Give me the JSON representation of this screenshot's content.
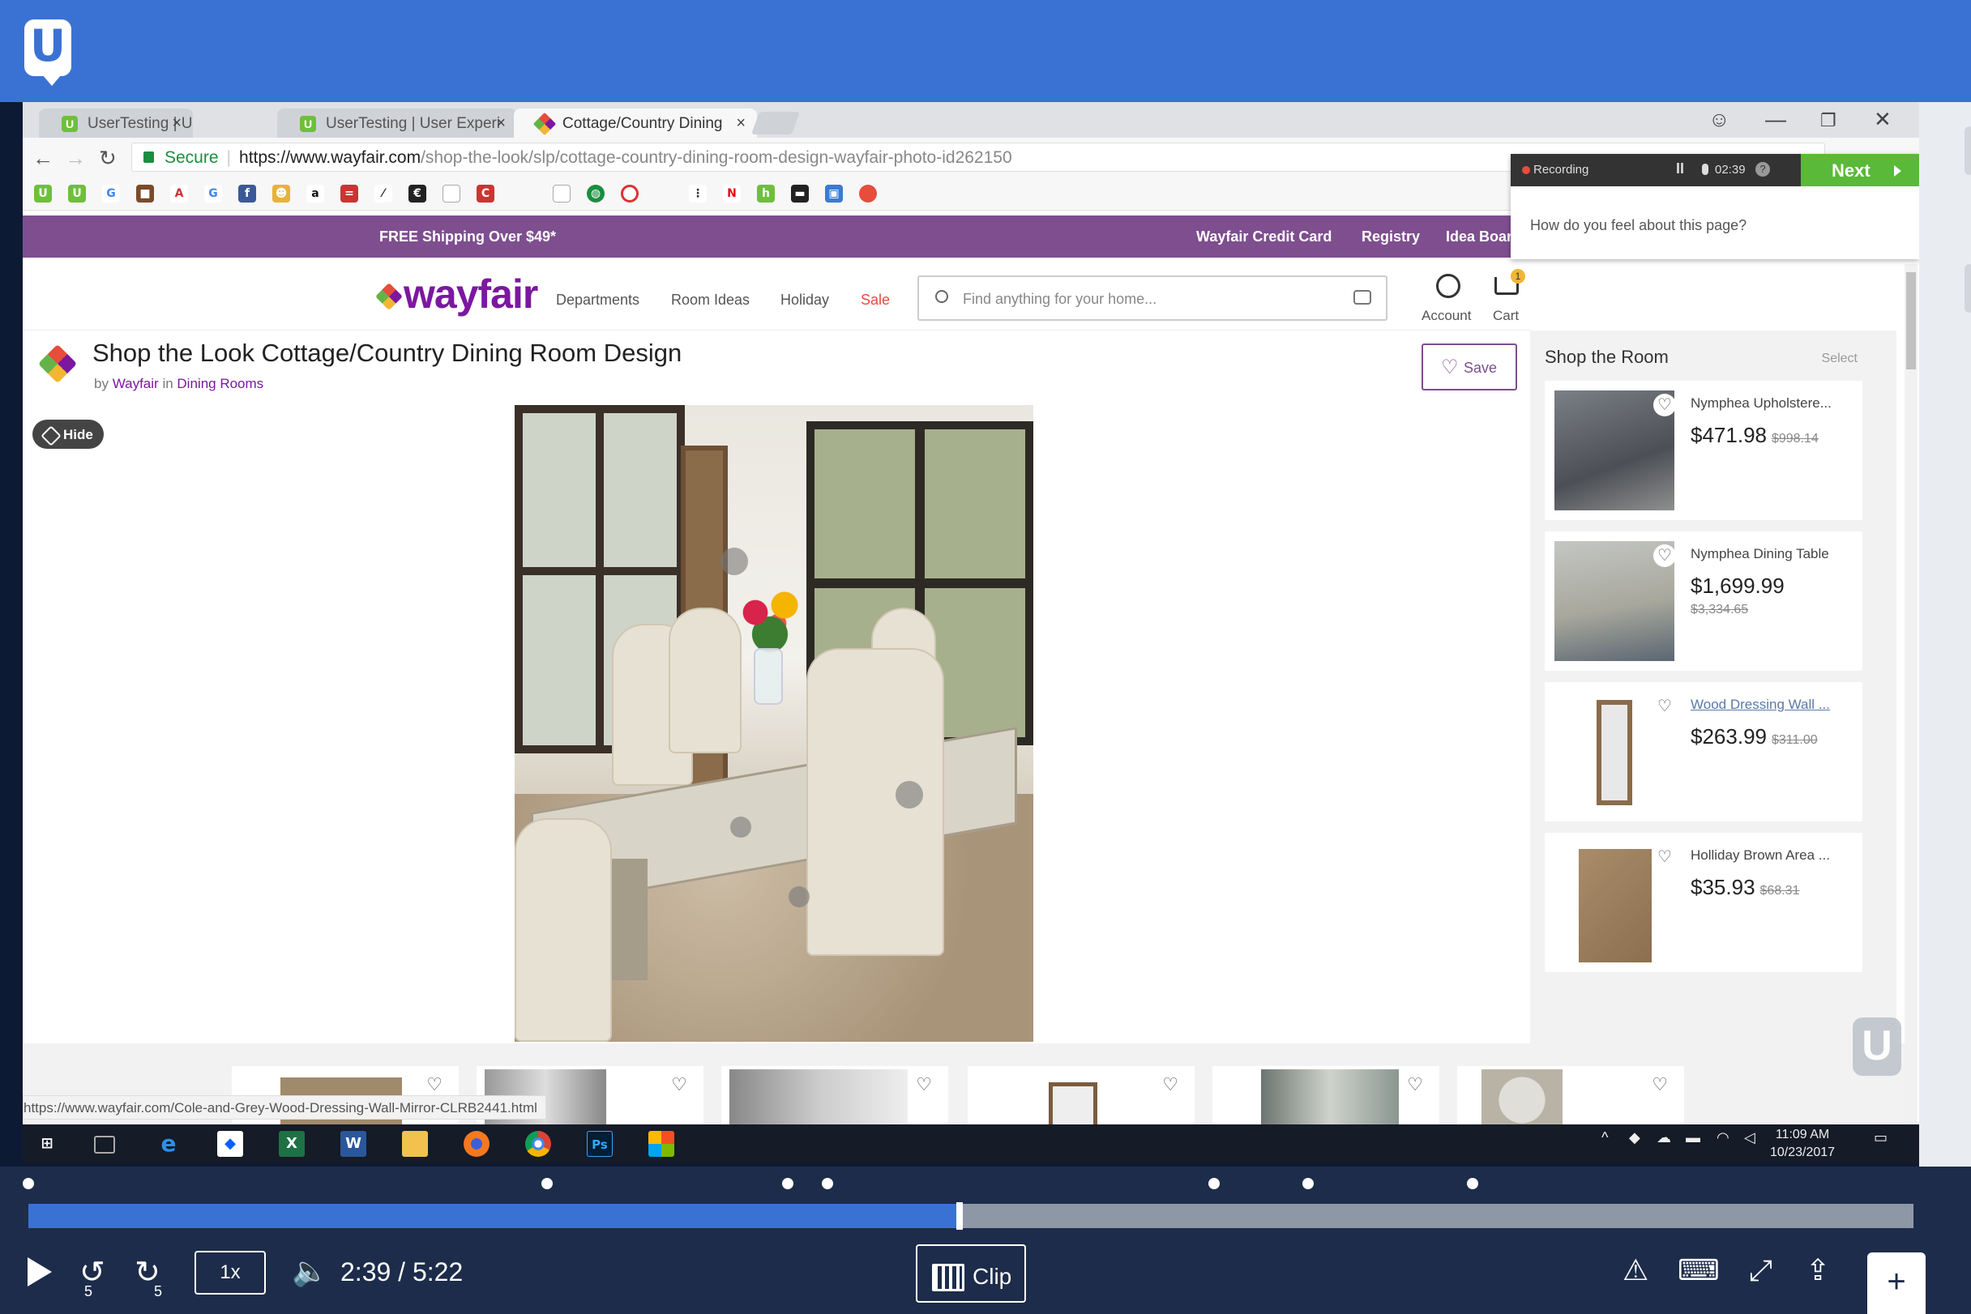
{
  "tabs": [
    {
      "label": "UserTesting | User Experi",
      "close": "×"
    },
    {
      "label": "UserTesting | User Experi",
      "close": "×"
    },
    {
      "label": "Cottage/Country Dining",
      "close": "×"
    }
  ],
  "window": {
    "account_icon": "user-circle-icon",
    "minimize": "—",
    "restore": "❐",
    "close": "✕"
  },
  "address": {
    "secure_label": "Secure",
    "host": "https://www.wayfair.com",
    "path": "/shop-the-look/slp/cottage-country-dining-room-design-wayfair-photo-id262150"
  },
  "promo": {
    "left": "FREE Shipping Over $49*",
    "links": [
      "Wayfair Credit Card",
      "Registry",
      "Idea Boar"
    ]
  },
  "header": {
    "logo": "wayfair",
    "nav": [
      "Departments",
      "Room Ideas",
      "Holiday",
      "Sale"
    ],
    "search_placeholder": "Find anything for your home...",
    "account_label": "Account",
    "cart_label": "Cart",
    "cart_count": "1"
  },
  "page": {
    "title": "Shop the Look Cottage/Country Dining Room Design",
    "by_prefix": "by",
    "by_author": "Wayfair",
    "by_in": "in",
    "by_category": "Dining Rooms",
    "save_label": "Save",
    "hide_label": "Hide"
  },
  "room": {
    "title": "Shop the Room",
    "select_label": "Select",
    "items": [
      {
        "name": "Nymphea Upholstere...",
        "price": "$471.98",
        "was": "$998.14"
      },
      {
        "name": "Nymphea Dining Table",
        "price": "$1,699.99",
        "was": "$3,334.65"
      },
      {
        "name": "Wood Dressing Wall ...",
        "price": "$263.99",
        "was": "$311.00"
      },
      {
        "name": "Holliday Brown Area ...",
        "price": "$35.93",
        "was": "$68.31"
      }
    ]
  },
  "status_url": "https://www.wayfair.com/Cole-and-Grey-Wood-Dressing-Wall-Mirror-CLRB2441.html",
  "recorder": {
    "status": "Recording",
    "time": "02:39",
    "next_label": "Next",
    "question": "How do you feel about this page?"
  },
  "taskbar": {
    "time": "11:09 AM",
    "date": "10/23/2017"
  },
  "player": {
    "skip_back": "5",
    "skip_forward": "5",
    "speed": "1x",
    "time": "2:39 / 5:22",
    "clip_label": "Clip",
    "progress": 0.494,
    "accent": "#3a72d4",
    "marker_positions": [
      0.0,
      0.275,
      0.403,
      0.424,
      0.629,
      0.679,
      0.766
    ]
  }
}
